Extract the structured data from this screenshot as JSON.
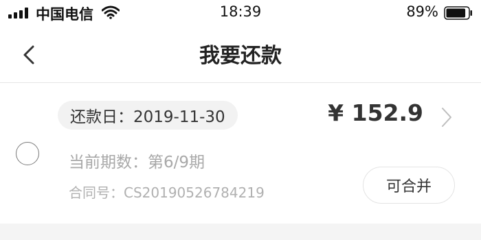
{
  "status_bar": {
    "carrier": "中国电信",
    "time": "18:39",
    "battery_percent": "89%",
    "battery_level": 0.89,
    "signal_bars": 4,
    "icons": [
      "signal-icon",
      "wifi-icon",
      "battery-icon"
    ]
  },
  "nav": {
    "title": "我要还款",
    "back_icon": "chevron-left-icon"
  },
  "repayment": {
    "due_date": "还款日：2019-11-30",
    "amount": "¥ 152.9",
    "period": "当前期数：第6/9期",
    "contract": "合同号：CS20190526784219",
    "merge_label": "可合并",
    "selected": false,
    "detail_icon": "chevron-right-icon"
  },
  "colors": {
    "text_primary": "#222222",
    "text_secondary": "#a8a8a8",
    "pill_background": "#f2f2f2",
    "divider": "#e6e6e6"
  }
}
